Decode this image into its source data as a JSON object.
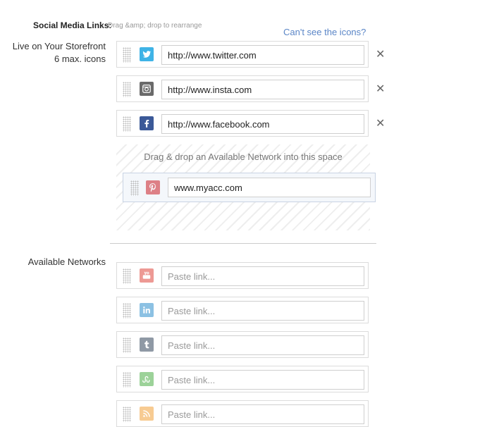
{
  "header": {
    "title": "Social Media Links:",
    "hint": "Drag &amp; drop to rearrange",
    "help_link": "Can't see the icons?"
  },
  "live": {
    "label_line1": "Live on Your Storefront",
    "label_line2": "6 max. icons",
    "rows": [
      {
        "network": "twitter",
        "icon": "twitter-icon",
        "color": "#3fb3e6",
        "value": "http://www.twitter.com",
        "remove": "✕"
      },
      {
        "network": "instagram",
        "icon": "instagram-icon",
        "color": "#6a6a6a",
        "value": "http://www.insta.com",
        "remove": "✕"
      },
      {
        "network": "facebook",
        "icon": "facebook-icon",
        "color": "#3b5998",
        "value": "http://www.facebook.com",
        "remove": "✕"
      }
    ]
  },
  "dropzone": {
    "text": "Drag & drop an Available Network into this space",
    "dragging": {
      "network": "pinterest",
      "icon": "pinterest-icon",
      "color": "#cb2027",
      "value": "www.myacc.com"
    }
  },
  "available": {
    "label": "Available Networks",
    "rows": [
      {
        "network": "youtube",
        "icon": "youtube-icon",
        "color": "#e0463d",
        "placeholder": "Paste link..."
      },
      {
        "network": "linkedin",
        "icon": "linkedin-icon",
        "color": "#2f8fcd",
        "placeholder": "Paste link..."
      },
      {
        "network": "tumblr",
        "icon": "tumblr-icon",
        "color": "#35465c",
        "placeholder": "Paste link..."
      },
      {
        "network": "stumbleupon",
        "icon": "stumbleupon-icon",
        "color": "#4cae46",
        "placeholder": "Paste link..."
      },
      {
        "network": "rss",
        "icon": "rss-icon",
        "color": "#f2a13a",
        "placeholder": "Paste link..."
      }
    ]
  }
}
